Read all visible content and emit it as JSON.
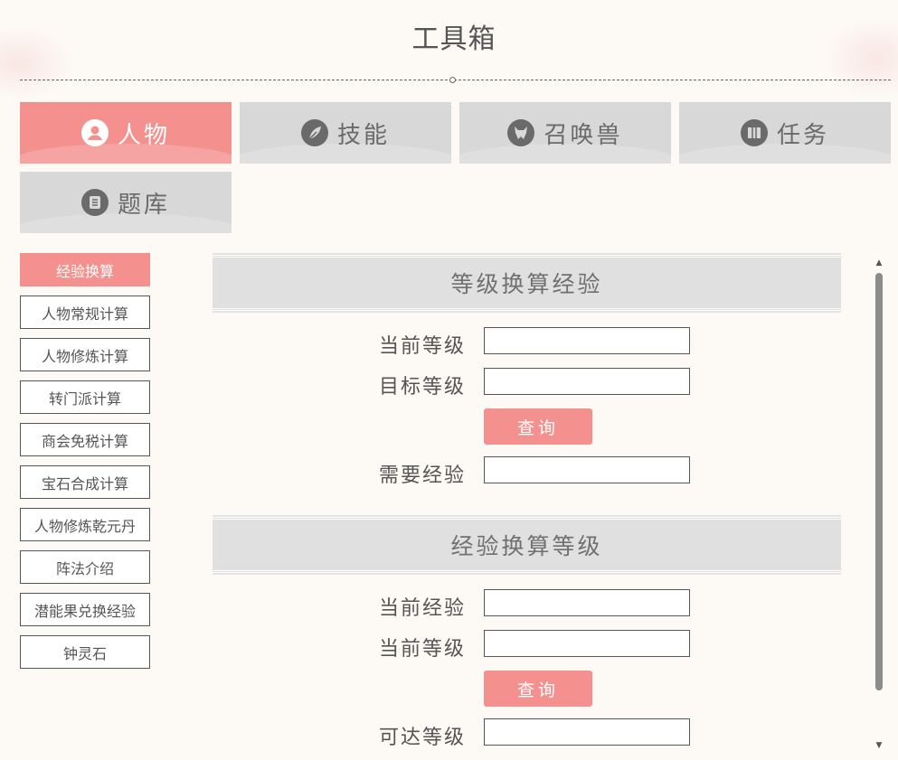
{
  "page": {
    "title": "工具箱"
  },
  "tabs": [
    {
      "label": "人物",
      "icon": "user-circle-icon",
      "active": true
    },
    {
      "label": "技能",
      "icon": "feather-icon",
      "active": false
    },
    {
      "label": "召唤兽",
      "icon": "beast-head-icon",
      "active": false
    },
    {
      "label": "任务",
      "icon": "map-icon",
      "active": false
    },
    {
      "label": "题库",
      "icon": "scroll-list-icon",
      "active": false
    }
  ],
  "sidebar": {
    "items": [
      {
        "label": "经验换算",
        "active": true
      },
      {
        "label": "人物常规计算"
      },
      {
        "label": "人物修炼计算"
      },
      {
        "label": "转门派计算"
      },
      {
        "label": "商会免税计算"
      },
      {
        "label": "宝石合成计算"
      },
      {
        "label": "人物修炼乾元丹"
      },
      {
        "label": "阵法介绍"
      },
      {
        "label": "潜能果兑换经验"
      },
      {
        "label": "钟灵石"
      }
    ]
  },
  "sections": [
    {
      "title": "等级换算经验",
      "fields": [
        {
          "label": "当前等级",
          "value": ""
        },
        {
          "label": "目标等级",
          "value": ""
        }
      ],
      "button": "查询",
      "result": {
        "label": "需要经验",
        "value": ""
      }
    },
    {
      "title": "经验换算等级",
      "fields": [
        {
          "label": "当前经验",
          "value": ""
        },
        {
          "label": "当前等级",
          "value": ""
        }
      ],
      "button": "查询",
      "result": {
        "label": "可达等级",
        "value": ""
      }
    }
  ],
  "colors": {
    "accent": "#f4918f",
    "tab_inactive": "#d8d8d8",
    "section_bg": "#e0e0e0",
    "page_bg": "#fdf9f5"
  }
}
